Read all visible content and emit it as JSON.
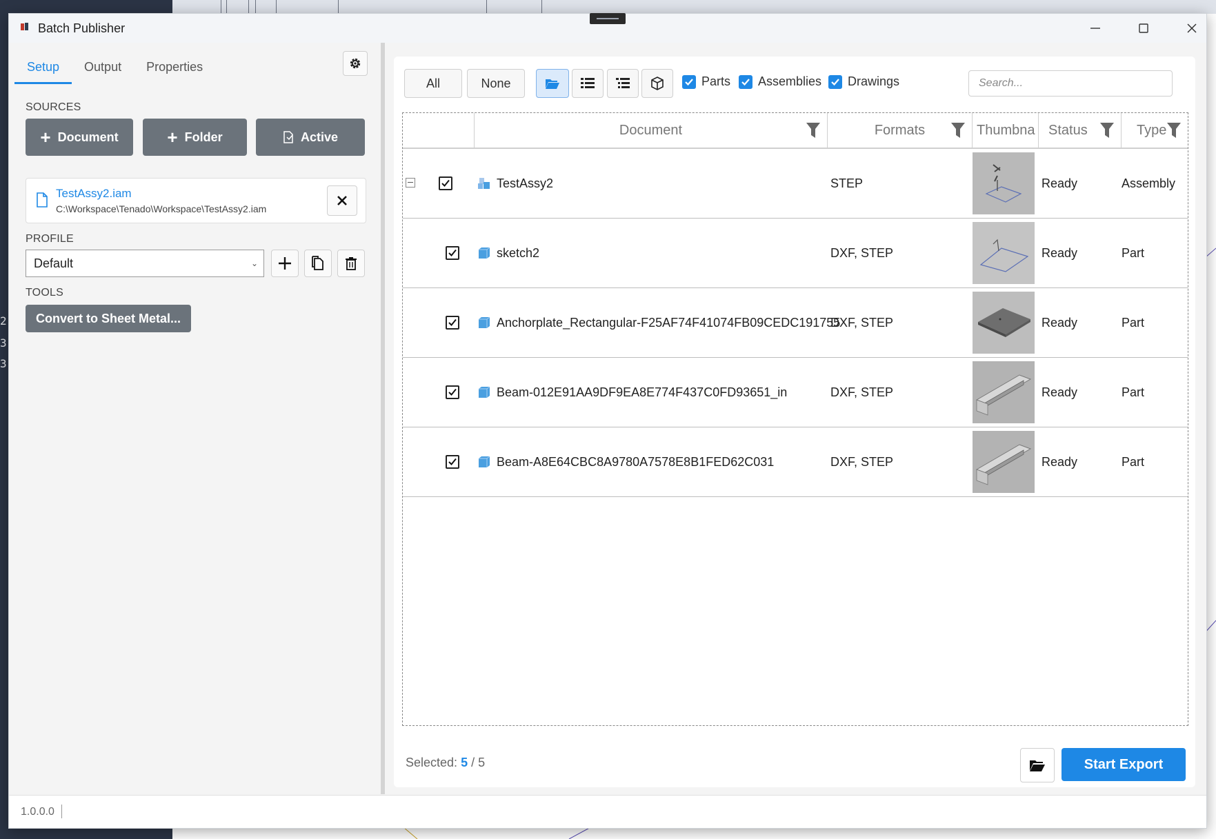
{
  "window": {
    "title": "Batch Publisher"
  },
  "tabs": [
    "Setup",
    "Output",
    "Properties"
  ],
  "sources": {
    "label": "SOURCES",
    "buttons": {
      "document": "Document",
      "folder": "Folder",
      "active": "Active"
    },
    "file": {
      "name": "TestAssy2.iam",
      "path": "C:\\Workspace\\Tenado\\Workspace\\TestAssy2.iam"
    }
  },
  "profile": {
    "label": "PROFILE",
    "selected": "Default"
  },
  "tools": {
    "label": "TOOLS",
    "convert": "Convert to Sheet Metal..."
  },
  "toolbar": {
    "all": "All",
    "none": "None",
    "filters": {
      "parts": "Parts",
      "assemblies": "Assemblies",
      "drawings": "Drawings"
    },
    "search_placeholder": "Search..."
  },
  "grid": {
    "headers": {
      "document": "Document",
      "formats": "Formats",
      "thumbnail": "Thumbna",
      "status": "Status",
      "type": "Type"
    },
    "rows": [
      {
        "name": "TestAssy2",
        "formats": "STEP",
        "status": "Ready",
        "type": "Assembly",
        "thumb": "assembly"
      },
      {
        "name": "sketch2",
        "formats": "DXF, STEP",
        "status": "Ready",
        "type": "Part",
        "thumb": "sketch"
      },
      {
        "name": "Anchorplate_Rectangular-F25AF74F41074FB09CEDC191755",
        "formats": "DXF, STEP",
        "status": "Ready",
        "type": "Part",
        "thumb": "plate"
      },
      {
        "name": "Beam-012E91AA9DF9EA8E774F437C0FD93651_in",
        "formats": "DXF, STEP",
        "status": "Ready",
        "type": "Part",
        "thumb": "beam"
      },
      {
        "name": "Beam-A8E64CBC8A9780A7578E8B1FED62C031",
        "formats": "DXF, STEP",
        "status": "Ready",
        "type": "Part",
        "thumb": "beam"
      }
    ]
  },
  "footer": {
    "selected_label": "Selected:",
    "selected_count": "5",
    "total": "/ 5",
    "start": "Start Export"
  },
  "status_bar": {
    "version": "1.0.0.0"
  },
  "background": {
    "side_numbers": [
      "2",
      "3",
      "3"
    ]
  },
  "colors": {
    "accent": "#1e88e5",
    "dark_button": "#6b737b",
    "part_icon": "#4a9fe0"
  }
}
